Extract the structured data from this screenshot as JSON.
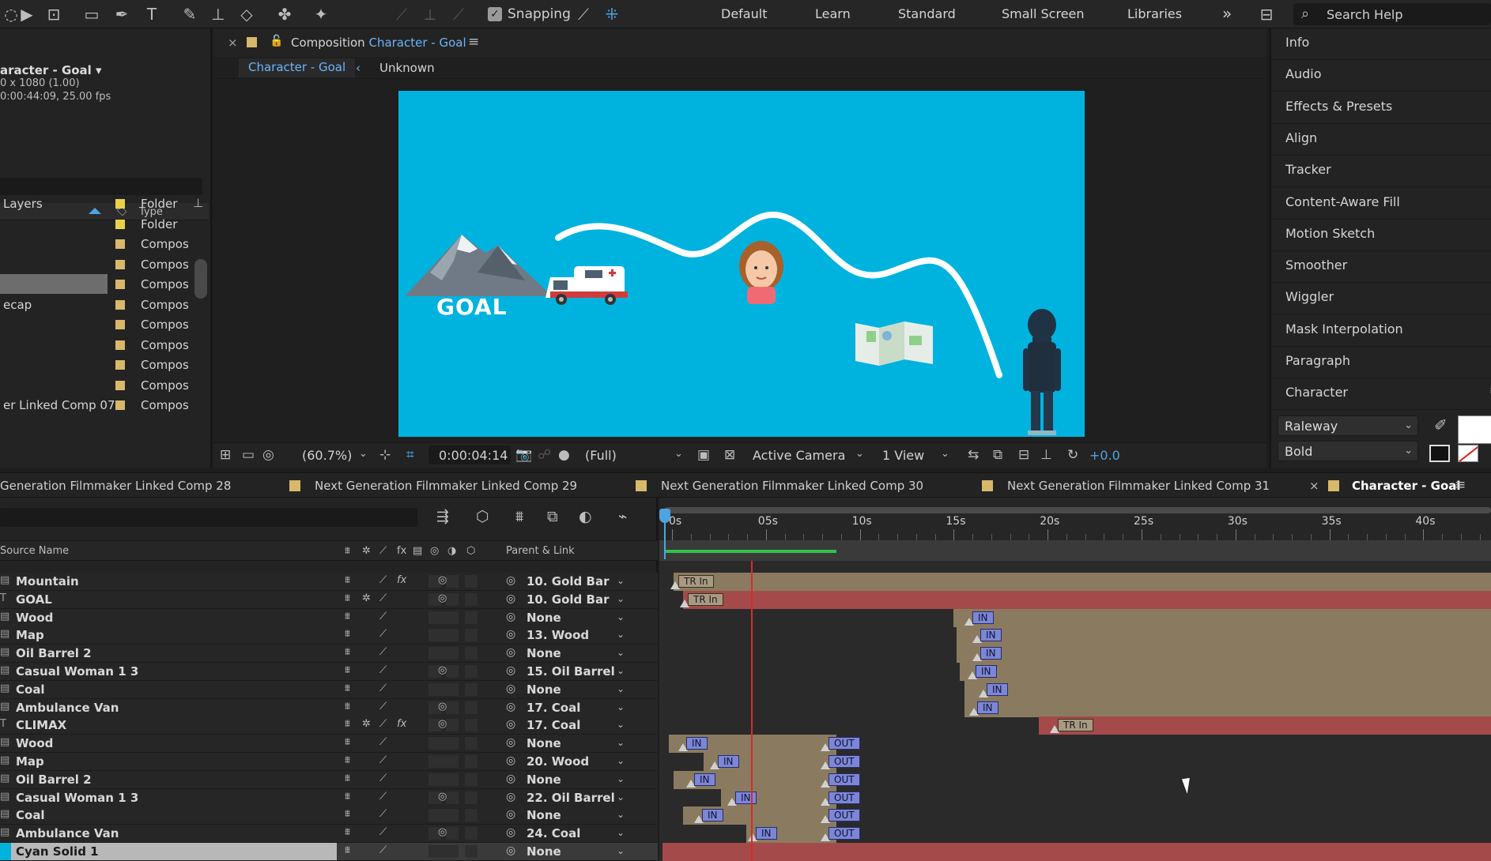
{
  "toolbar": {
    "snapping_label": "Snapping",
    "workspaces": [
      "Default",
      "Learn",
      "Standard",
      "Small Screen",
      "Libraries"
    ],
    "search_placeholder": "Search Help"
  },
  "project": {
    "comp_name": "aracter - Goal",
    "comp_dims": "0 x 1080 (1.00)",
    "comp_duration": "0:00:44:09, 25.00 fps",
    "type_header": "Type",
    "items": [
      {
        "name": "Layers",
        "type": "Folder",
        "color": "#e8d24a"
      },
      {
        "name": "",
        "type": "Folder",
        "color": "#e8d24a"
      },
      {
        "name": "",
        "type": "Compos",
        "color": "#d8b86a"
      },
      {
        "name": "",
        "type": "Compos",
        "color": "#d8b86a"
      },
      {
        "name": "",
        "type": "Compos",
        "color": "#d8b86a",
        "selected": true
      },
      {
        "name": "ecap",
        "type": "Compos",
        "color": "#d8b86a"
      },
      {
        "name": "",
        "type": "Compos",
        "color": "#d8b86a"
      },
      {
        "name": "",
        "type": "Compos",
        "color": "#d8b86a"
      },
      {
        "name": "",
        "type": "Compos",
        "color": "#d8b86a"
      },
      {
        "name": "",
        "type": "Compos",
        "color": "#d8b86a"
      },
      {
        "name": "er Linked Comp 07",
        "type": "Compos",
        "color": "#d8b86a"
      }
    ]
  },
  "viewer": {
    "panel_prefix": "Composition",
    "comp_name": "Character - Goal",
    "breadcrumb_active": "Character - Goal",
    "breadcrumb_other": "Unknown",
    "canvas_text": "GOAL",
    "zoom": "(60.7%)",
    "timecode": "0:00:04:14",
    "resolution": "(Full)",
    "camera": "Active Camera",
    "views": "1 View",
    "exposure": "+0.0"
  },
  "right_panel": {
    "items": [
      "Info",
      "Audio",
      "Effects & Presets",
      "Align",
      "Tracker",
      "Content-Aware Fill",
      "Motion Sketch",
      "Smoother",
      "Wiggler",
      "Mask Interpolation",
      "Paragraph",
      "Character"
    ],
    "font_family": "Raleway",
    "font_style": "Bold"
  },
  "timeline": {
    "tabs": [
      "Generation Filmmaker Linked Comp 28",
      "Next Generation Filmmaker Linked Comp 29",
      "Next Generation Filmmaker Linked Comp 30",
      "Next Generation Filmmaker Linked Comp 31",
      "Character - Goal"
    ],
    "col_source_name": "Source Name",
    "col_parent": "Parent & Link",
    "ruler_labels": [
      "0s",
      "05s",
      "10s",
      "15s",
      "20s",
      "25s",
      "30s",
      "35s",
      "40s"
    ],
    "layers": [
      {
        "name": "Mountain",
        "parent": "10. Gold Bar",
        "fx": true,
        "type": "comp"
      },
      {
        "name": "GOAL",
        "parent": "10. Gold Bar",
        "fx": false,
        "type": "text"
      },
      {
        "name": "Wood",
        "parent": "None",
        "fx": false,
        "type": "comp"
      },
      {
        "name": "Map",
        "parent": "13. Wood",
        "fx": false,
        "type": "comp"
      },
      {
        "name": "Oil Barrel 2",
        "parent": "None",
        "fx": false,
        "type": "comp"
      },
      {
        "name": "Casual Woman 1 3",
        "parent": "15. Oil Barrel",
        "fx": false,
        "type": "comp"
      },
      {
        "name": "Coal",
        "parent": "None",
        "fx": false,
        "type": "comp"
      },
      {
        "name": "Ambulance Van",
        "parent": "17. Coal",
        "fx": false,
        "type": "comp"
      },
      {
        "name": "CLIMAX",
        "parent": "17. Coal",
        "fx": true,
        "type": "text"
      },
      {
        "name": "Wood",
        "parent": "None",
        "fx": false,
        "type": "comp"
      },
      {
        "name": "Map",
        "parent": "20. Wood",
        "fx": false,
        "type": "comp"
      },
      {
        "name": "Oil Barrel 2",
        "parent": "None",
        "fx": false,
        "type": "comp"
      },
      {
        "name": "Casual Woman 1 3",
        "parent": "22. Oil Barrel",
        "fx": false,
        "type": "comp"
      },
      {
        "name": "Coal",
        "parent": "None",
        "fx": false,
        "type": "comp"
      },
      {
        "name": "Ambulance Van",
        "parent": "24. Coal",
        "fx": false,
        "type": "comp"
      },
      {
        "name": "Cyan Solid 1",
        "parent": "None",
        "fx": false,
        "type": "solid",
        "selected": true
      }
    ],
    "kf_labels": {
      "tr_in": "TR In",
      "in": "IN",
      "out": "OUT"
    }
  }
}
